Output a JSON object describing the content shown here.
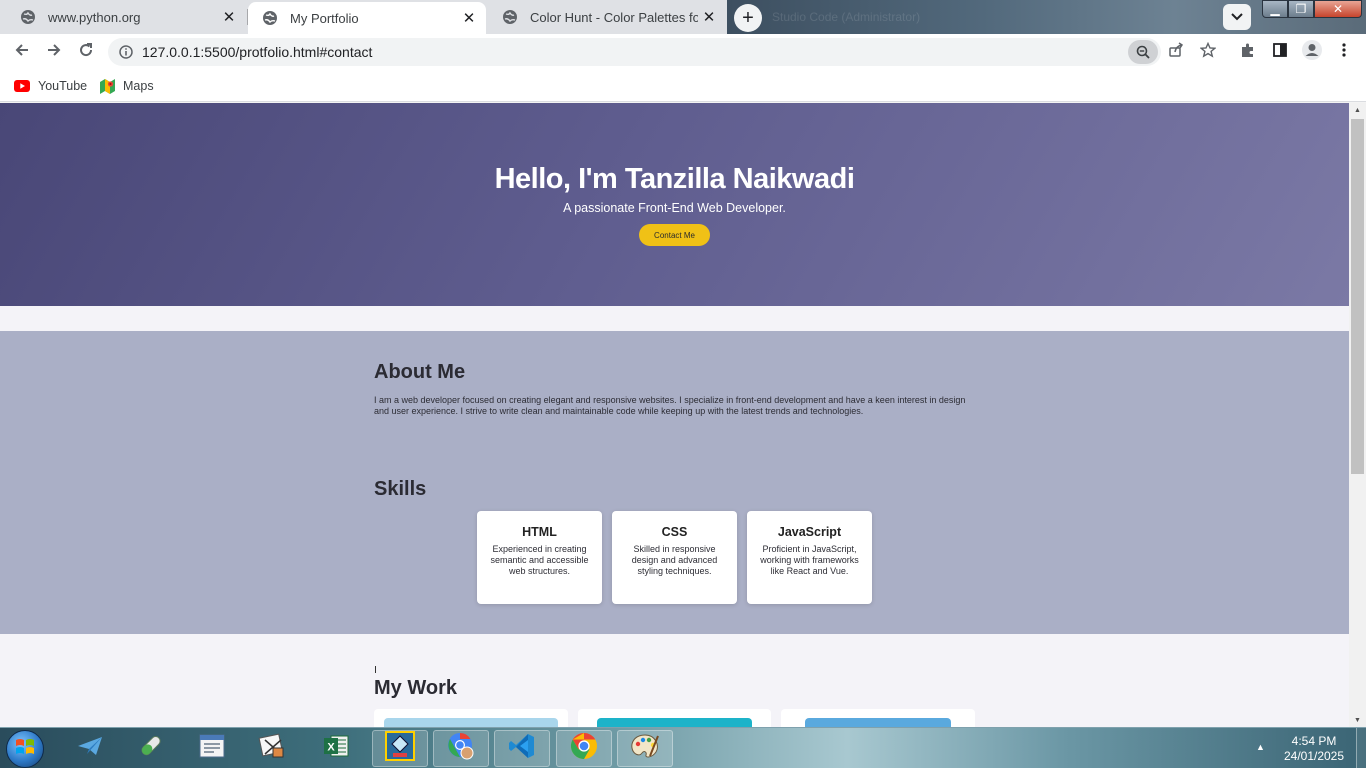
{
  "browser": {
    "tabs": [
      {
        "title": "www.python.org",
        "active": false
      },
      {
        "title": "My Portfolio",
        "active": true
      },
      {
        "title": "Color Hunt - Color Palettes for De",
        "active": false
      }
    ],
    "ghost_window_title": "Studio Code (Administrator)",
    "window_controls": {
      "minimize": "▁",
      "maximize": "❐",
      "close": "✕"
    },
    "url": "127.0.0.1:5500/protfolio.html#contact",
    "bookmarks": [
      {
        "label": "YouTube",
        "icon": "youtube-icon"
      },
      {
        "label": "Maps",
        "icon": "maps-icon"
      }
    ]
  },
  "page": {
    "hero": {
      "title": "Hello, I'm Tanzilla Naikwadi",
      "subtitle": "A passionate Front-End Web Developer.",
      "button": "Contact Me"
    },
    "about": {
      "heading": "About Me",
      "text": "I am a web developer focused on creating elegant and responsive websites. I specialize in front-end development and have a keen interest in design and user experience. I strive to write clean and maintainable code while keeping up with the latest trends and technologies."
    },
    "skills": {
      "heading": "Skills",
      "items": [
        {
          "name": "HTML",
          "desc": "Experienced in creating semantic and accessible web structures."
        },
        {
          "name": "CSS",
          "desc": "Skilled in responsive design and advanced styling techniques."
        },
        {
          "name": "JavaScript",
          "desc": "Proficient in JavaScript, working with frameworks like React and Vue."
        }
      ]
    },
    "work": {
      "heading": "My Work"
    }
  },
  "taskbar": {
    "apps": [
      "paper-plane-icon",
      "pill-icon",
      "document-icon",
      "graph-paper-icon",
      "excel-icon",
      "game-icon",
      "chrome-profile-icon",
      "vscode-icon",
      "chrome-icon",
      "paint-icon"
    ],
    "clock_time": "4:54 PM",
    "clock_date": "24/01/2025",
    "tray_arrow": "▲"
  },
  "colors": {
    "hero_start": "#494777",
    "hero_end": "#7b79a5",
    "about_bg": "#aaafc6",
    "accent_button": "#f0c116",
    "page_bg": "#f4f3f8"
  }
}
